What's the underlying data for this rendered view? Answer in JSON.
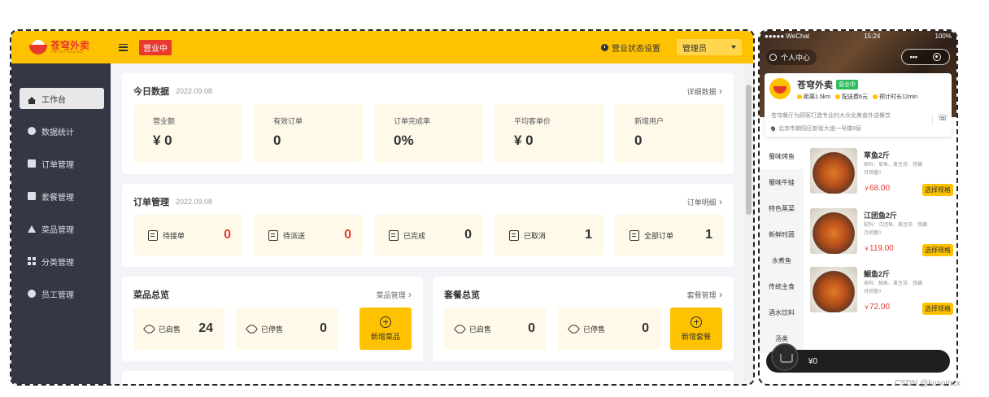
{
  "topbar": {
    "logo_text": "苍穹外卖",
    "logo_subtext": "THE SKY TAKE-OUT",
    "status_tag": "营业中",
    "status_setting": "营业状态设置",
    "admin": "管理员"
  },
  "sidebar": {
    "items": [
      {
        "label": "工作台",
        "icon": "home-icon"
      },
      {
        "label": "数据统计",
        "icon": "stats-icon"
      },
      {
        "label": "订单管理",
        "icon": "order-icon"
      },
      {
        "label": "套餐管理",
        "icon": "combo-icon"
      },
      {
        "label": "菜品管理",
        "icon": "dish-icon"
      },
      {
        "label": "分类管理",
        "icon": "category-icon"
      },
      {
        "label": "员工管理",
        "icon": "employee-icon"
      }
    ]
  },
  "today": {
    "title": "今日数据",
    "date": "2022.09.08",
    "link": "详细数据",
    "stats": [
      {
        "label": "营业额",
        "value": "¥ 0"
      },
      {
        "label": "有效订单",
        "value": "0"
      },
      {
        "label": "订单完成率",
        "value": "0%"
      },
      {
        "label": "平均客单价",
        "value": "¥ 0"
      },
      {
        "label": "新增用户",
        "value": "0"
      }
    ]
  },
  "orders": {
    "title": "订单管理",
    "date": "2022.09.08",
    "link": "订单明细",
    "items": [
      {
        "label": "待接单",
        "value": "0"
      },
      {
        "label": "待派送",
        "value": "0"
      },
      {
        "label": "已完成",
        "value": "0"
      },
      {
        "label": "已取消",
        "value": "1"
      },
      {
        "label": "全部订单",
        "value": "1"
      }
    ]
  },
  "dish_overview": {
    "title": "菜品总览",
    "link": "菜品管理",
    "on_sale_label": "已启售",
    "on_sale": "24",
    "off_sale_label": "已停售",
    "off_sale": "0",
    "add": "新增菜品"
  },
  "combo_overview": {
    "title": "套餐总览",
    "link": "套餐管理",
    "on_sale_label": "已启售",
    "on_sale": "0",
    "off_sale_label": "已停售",
    "off_sale": "0",
    "add": "新增套餐"
  },
  "phone": {
    "carrier": "●●●●● WeChat",
    "time": "15:24",
    "battery": "100%",
    "personal": "个人中心",
    "capsule_dots": "•••",
    "shop_name": "苍穹外卖",
    "open_badge": "营业中",
    "meta": [
      "距离1.5km",
      "配送费6元",
      "预计时长12min"
    ],
    "desc": "苍穹餐厅为顾客打造专业的大众化美食外送餐饮",
    "address": "北京市朝阳区新街大道一号楼8层",
    "categories": [
      "蜀味烤鱼",
      "蜀味牛蛙",
      "特色蒸菜",
      "新鲜时蔬",
      "水煮鱼",
      "传统主食",
      "酒水饮料",
      "汤类"
    ],
    "dishes": [
      {
        "name": "草鱼2斤",
        "desc": "原料：草鱼、黄豆芽、莲藕",
        "sales": "月销量0",
        "price_symbol": "￥",
        "price": "68.00",
        "button": "选择规格"
      },
      {
        "name": "江团鱼2斤",
        "desc": "配料：江团鱼、黄豆芽、莲藕",
        "sales": "月销量0",
        "price_symbol": "￥",
        "price": "119.00",
        "button": "选择规格"
      },
      {
        "name": "鮰鱼2斤",
        "desc": "原料：鮰鱼、黄豆芽、莲藕",
        "sales": "月销量0",
        "price_symbol": "￥",
        "price": "72.00",
        "button": "选择规格"
      }
    ],
    "cart_total": "¥0"
  },
  "watermark": "CSDN @kusomcx",
  "colors": {
    "brand": "#ffc200",
    "sidebar": "#343744",
    "danger": "#e8392d",
    "open": "#2dbd5a"
  }
}
